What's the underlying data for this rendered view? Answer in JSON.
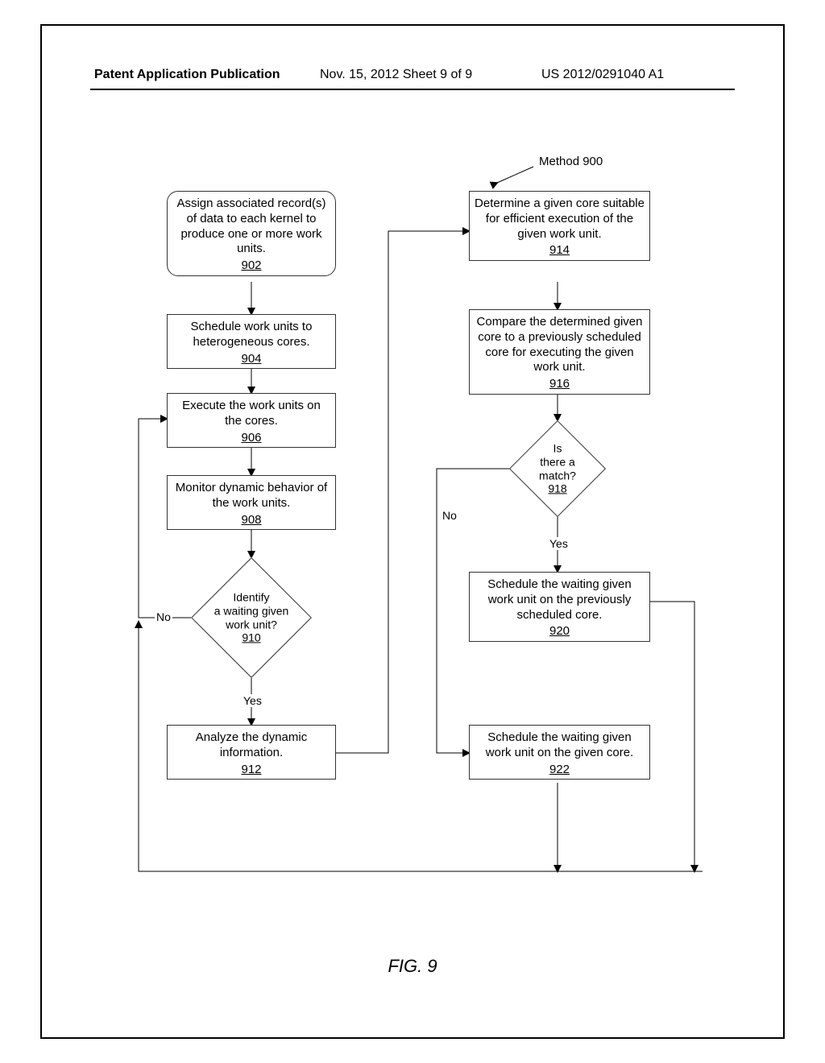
{
  "header": {
    "left": "Patent Application Publication",
    "mid": "Nov. 15, 2012   Sheet 9 of 9",
    "right": "US 2012/0291040 A1"
  },
  "method_label": "Method 900",
  "boxes": {
    "b902": {
      "text": "Assign associated record(s) of data to each kernel to produce one or more work units.",
      "ref": "902"
    },
    "b904": {
      "text": "Schedule work units to heterogeneous cores.",
      "ref": "904"
    },
    "b906": {
      "text": "Execute the work units on the cores.",
      "ref": "906"
    },
    "b908": {
      "text": "Monitor dynamic behavior of the work units.",
      "ref": "908"
    },
    "b912": {
      "text": "Analyze the dynamic information.",
      "ref": "912"
    },
    "b914": {
      "text": "Determine a given core suitable for efficient execution of the given work unit.",
      "ref": "914"
    },
    "b916": {
      "text": "Compare the determined given core to a previously scheduled core for executing the given work unit.",
      "ref": "916"
    },
    "b920": {
      "text": "Schedule the waiting given work unit on the previously scheduled core.",
      "ref": "920"
    },
    "b922": {
      "text": "Schedule the waiting given work unit on the given core.",
      "ref": "922"
    }
  },
  "diamonds": {
    "d910": {
      "l1": "Identify",
      "l2": "a waiting given",
      "l3": "work unit?",
      "ref": "910"
    },
    "d918": {
      "l1": "Is",
      "l2": "there a",
      "l3": "match?",
      "ref": "918"
    }
  },
  "labels": {
    "no": "No",
    "yes": "Yes"
  },
  "figure": "FIG. 9",
  "chart_data": {
    "type": "flowchart",
    "title": "Method 900",
    "nodes": [
      {
        "id": "902",
        "kind": "process",
        "text": "Assign associated record(s) of data to each kernel to produce one or more work units."
      },
      {
        "id": "904",
        "kind": "process",
        "text": "Schedule work units to heterogeneous cores."
      },
      {
        "id": "906",
        "kind": "process",
        "text": "Execute the work units on the cores."
      },
      {
        "id": "908",
        "kind": "process",
        "text": "Monitor dynamic behavior of the work units."
      },
      {
        "id": "910",
        "kind": "decision",
        "text": "Identify a waiting given work unit?"
      },
      {
        "id": "912",
        "kind": "process",
        "text": "Analyze the dynamic information."
      },
      {
        "id": "914",
        "kind": "process",
        "text": "Determine a given core suitable for efficient execution of the given work unit."
      },
      {
        "id": "916",
        "kind": "process",
        "text": "Compare the determined given core to a previously scheduled core for executing the given work unit."
      },
      {
        "id": "918",
        "kind": "decision",
        "text": "Is there a match?"
      },
      {
        "id": "920",
        "kind": "process",
        "text": "Schedule the waiting given work unit on the previously scheduled core."
      },
      {
        "id": "922",
        "kind": "process",
        "text": "Schedule the waiting given work unit on the given core."
      }
    ],
    "edges": [
      {
        "from": "902",
        "to": "904"
      },
      {
        "from": "904",
        "to": "906"
      },
      {
        "from": "906",
        "to": "908"
      },
      {
        "from": "908",
        "to": "910"
      },
      {
        "from": "910",
        "to": "912",
        "label": "Yes"
      },
      {
        "from": "910",
        "to": "906",
        "label": "No"
      },
      {
        "from": "912",
        "to": "914"
      },
      {
        "from": "914",
        "to": "916"
      },
      {
        "from": "916",
        "to": "918"
      },
      {
        "from": "918",
        "to": "920",
        "label": "Yes"
      },
      {
        "from": "918",
        "to": "922",
        "label": "No"
      },
      {
        "from": "920",
        "to": "906"
      },
      {
        "from": "922",
        "to": "906"
      }
    ]
  }
}
